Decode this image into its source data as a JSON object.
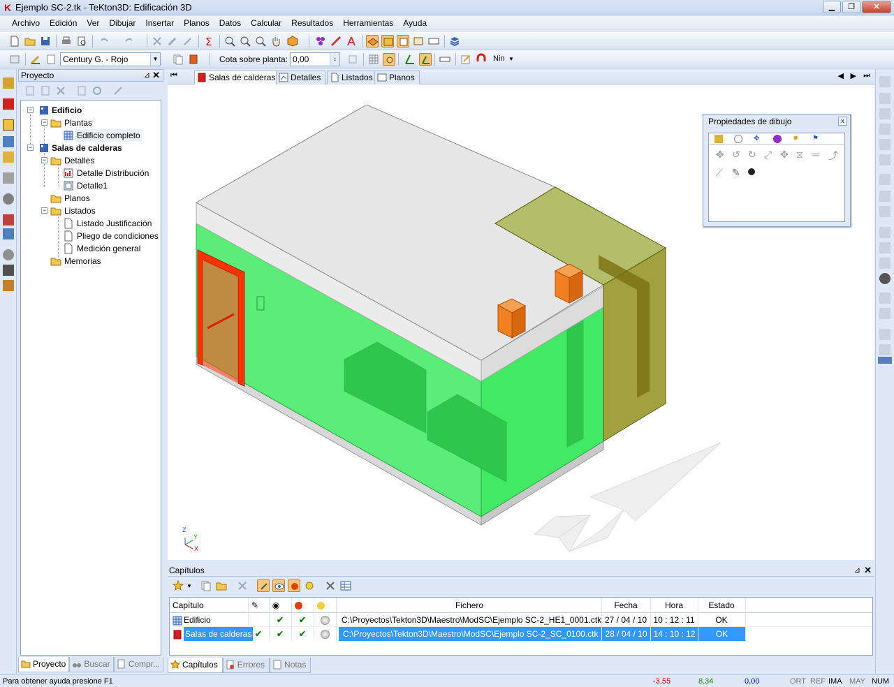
{
  "window": {
    "title": "Ejemplo SC-2.tk - TeKton3D: Edificación 3D",
    "minimize": "▁",
    "restore": "❐",
    "close": "✕"
  },
  "menu": [
    "Archivo",
    "Edición",
    "Ver",
    "Dibujar",
    "Insertar",
    "Planos",
    "Datos",
    "Calcular",
    "Resultados",
    "Herramientas",
    "Ayuda"
  ],
  "toolbar2": {
    "font_combo": "Century G. - Rojo",
    "cota_label": "Cota sobre planta:",
    "cota_value": "0,00",
    "nin_label": "Nin"
  },
  "project_panel": {
    "title": "Proyecto",
    "tree": {
      "edificio": "Edificio",
      "plantas": "Plantas",
      "edificio_completo": "Edificio completo",
      "salas": "Salas de calderas",
      "detalles": "Detalles",
      "detalle_distribucion": "Detalle Distribución",
      "detalle1": "Detalle1",
      "planos": "Planos",
      "listados": "Listados",
      "listado_justificacion": "Listado Justificación",
      "pliego": "Pliego de condiciones",
      "medicion": "Medición general",
      "memorias": "Memorias"
    },
    "tabs": [
      "Proyecto",
      "Buscar",
      "Compr..."
    ]
  },
  "doc_tabs": [
    "Salas de calderas",
    "Detalles",
    "Listados",
    "Planos"
  ],
  "viewport": {
    "axis_z": "Z",
    "axis_y": "Y",
    "axis_x": "X"
  },
  "properties_panel": {
    "title": "Propiedades de dibujo",
    "close": "x"
  },
  "capitulos": {
    "title": "Capítulos",
    "columns": {
      "capitulo": "Capítulo",
      "fichero": "Fichero",
      "fecha": "Fecha",
      "hora": "Hora",
      "estado": "Estado"
    },
    "rows": [
      {
        "capitulo": "Edificio",
        "fichero": "C:\\Proyectos\\Tekton3D\\Maestro\\ModSC\\Ejemplo SC-2_HE1_0001.ctk",
        "fecha": "27 / 04 / 10",
        "hora": "10 : 12 : 11",
        "estado": "OK"
      },
      {
        "capitulo": "Salas de calderas",
        "fichero": "C:\\Proyectos\\Tekton3D\\Maestro\\ModSC\\Ejemplo SC-2_SC_0100.ctk",
        "fecha": "28 / 04 / 10",
        "hora": "14 : 10 : 12",
        "estado": "OK"
      }
    ],
    "check": "✔",
    "tabs": [
      "Capítulos",
      "Errores",
      "Notas"
    ]
  },
  "status": {
    "help": "Para obtener ayuda presione F1",
    "x": "-3,55",
    "y": "8,34",
    "z": "0,00",
    "ort": "ORT",
    "ref": "REF",
    "ima": "IMA",
    "may": "MAY",
    "num": "NUM"
  },
  "colors": {
    "accent": "#3399ff",
    "green_wall": "#33e659",
    "door": "#ff3300",
    "box_orange": "#f08020"
  }
}
